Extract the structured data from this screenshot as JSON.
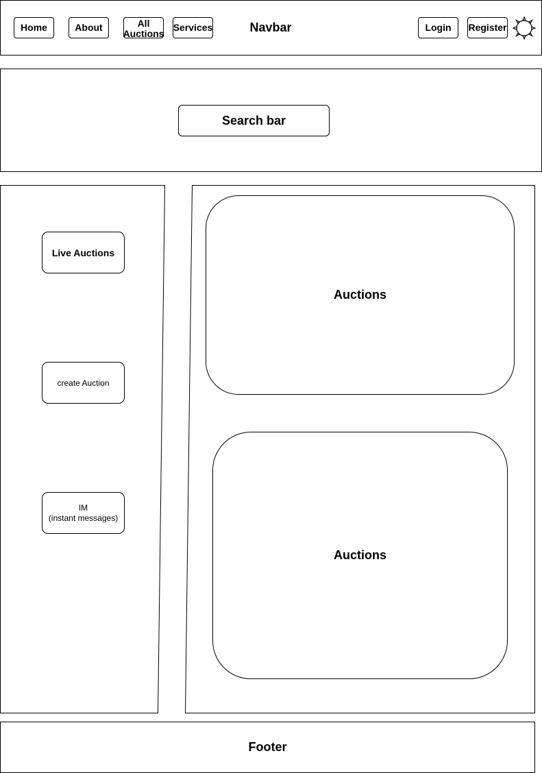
{
  "navbar": {
    "title": "Navbar",
    "items": [
      {
        "label": "Home"
      },
      {
        "label": "About"
      },
      {
        "label": "All Auctions"
      },
      {
        "label": "Services"
      }
    ],
    "login_label": "Login",
    "register_label": "Register",
    "theme_icon": "sun-icon"
  },
  "search": {
    "label": "Search bar"
  },
  "sidebar": {
    "items": [
      {
        "label": "Live Auctions"
      },
      {
        "label": "create Auction"
      },
      {
        "label": "IM\n(instant messages)"
      }
    ]
  },
  "main": {
    "cards": [
      {
        "label": "Auctions"
      },
      {
        "label": "Auctions"
      }
    ]
  },
  "footer": {
    "label": "Footer"
  }
}
